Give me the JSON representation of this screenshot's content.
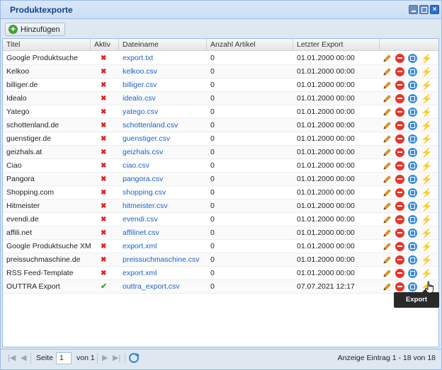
{
  "window": {
    "title": "Produktexporte"
  },
  "toolbar": {
    "add_label": "Hinzufügen"
  },
  "grid": {
    "columns": [
      "Titel",
      "Aktiv",
      "Dateiname",
      "Anzahl Artikel",
      "Letzter Export"
    ],
    "rows": [
      {
        "title": "Google Produktsuche",
        "active": false,
        "file": "export.txt",
        "count": "0",
        "last_export": "01.01.2000 00:00"
      },
      {
        "title": "Kelkoo",
        "active": false,
        "file": "kelkoo.csv",
        "count": "0",
        "last_export": "01.01.2000 00:00"
      },
      {
        "title": "billiger.de",
        "active": false,
        "file": "billiger.csv",
        "count": "0",
        "last_export": "01.01.2000 00:00"
      },
      {
        "title": "Idealo",
        "active": false,
        "file": "idealo.csv",
        "count": "0",
        "last_export": "01.01.2000 00:00"
      },
      {
        "title": "Yatego",
        "active": false,
        "file": "yatego.csv",
        "count": "0",
        "last_export": "01.01.2000 00:00"
      },
      {
        "title": "schottenland.de",
        "active": false,
        "file": "schottenland.csv",
        "count": "0",
        "last_export": "01.01.2000 00:00"
      },
      {
        "title": "guenstiger.de",
        "active": false,
        "file": "guenstiger.csv",
        "count": "0",
        "last_export": "01.01.2000 00:00"
      },
      {
        "title": "geizhals.at",
        "active": false,
        "file": "geizhals.csv",
        "count": "0",
        "last_export": "01.01.2000 00:00"
      },
      {
        "title": "Ciao",
        "active": false,
        "file": "ciao.csv",
        "count": "0",
        "last_export": "01.01.2000 00:00"
      },
      {
        "title": "Pangora",
        "active": false,
        "file": "pangora.csv",
        "count": "0",
        "last_export": "01.01.2000 00:00"
      },
      {
        "title": "Shopping.com",
        "active": false,
        "file": "shopping.csv",
        "count": "0",
        "last_export": "01.01.2000 00:00"
      },
      {
        "title": "Hitmeister",
        "active": false,
        "file": "hitmeister.csv",
        "count": "0",
        "last_export": "01.01.2000 00:00"
      },
      {
        "title": "evendi.de",
        "active": false,
        "file": "evendi.csv",
        "count": "0",
        "last_export": "01.01.2000 00:00"
      },
      {
        "title": "affili.net",
        "active": false,
        "file": "affilinet.csv",
        "count": "0",
        "last_export": "01.01.2000 00:00"
      },
      {
        "title": "Google Produktsuche XML",
        "active": false,
        "file": "export.xml",
        "count": "0",
        "last_export": "01.01.2000 00:00"
      },
      {
        "title": "preissuchmaschine.de",
        "active": false,
        "file": "preissuchmaschine.csv",
        "count": "0",
        "last_export": "01.01.2000 00:00"
      },
      {
        "title": "RSS Feed-Template",
        "active": false,
        "file": "export.xml",
        "count": "0",
        "last_export": "01.01.2000 00:00"
      },
      {
        "title": "OUTTRA Export",
        "active": true,
        "file": "outtra_export.csv",
        "count": "0",
        "last_export": "07.07.2021 12:17"
      }
    ]
  },
  "tooltip": {
    "text": "Export starten"
  },
  "pager": {
    "page_label": "Seite",
    "page_value": "1",
    "of_label": "von 1",
    "display_text": "Anzeige Eintrag 1 - 18 von 18"
  },
  "colors": {
    "inactive": "#e02020",
    "active": "#3aa331",
    "link": "#1a63c9"
  }
}
